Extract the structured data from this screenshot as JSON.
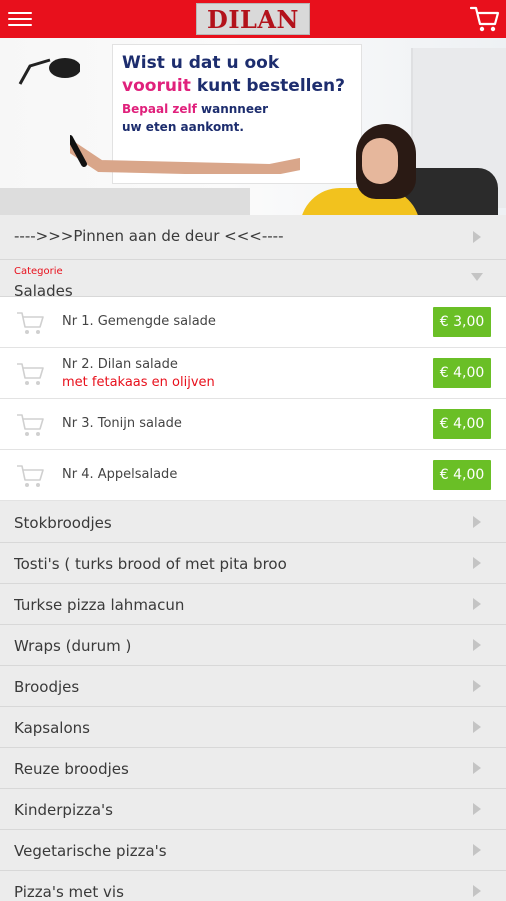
{
  "header": {
    "brand": "DILAN",
    "menu_icon": "hamburger-menu-icon",
    "cart_icon": "shopping-cart-icon",
    "bar_color": "#e8101c"
  },
  "banner": {
    "line1": "Wist u dat u ook",
    "line2_a": "vooruit",
    "line2_b": "kunt bestellen?",
    "line3_a": "Bepaal zelf",
    "line3_b": "wannneer",
    "line4": "uw eten aankomt."
  },
  "notice": {
    "label": "---->>>Pinnen aan de deur <<<----"
  },
  "category": {
    "caption": "Categorie",
    "selected": "Salades"
  },
  "items": [
    {
      "name": "Nr 1. Gemengde salade",
      "desc": "",
      "price": "€ 3,00"
    },
    {
      "name": "Nr 2. Dilan salade",
      "desc": "met fetakaas en olijven",
      "price": "€ 4,00"
    },
    {
      "name": "Nr 3. Tonijn salade",
      "desc": "",
      "price": "€ 4,00"
    },
    {
      "name": "Nr 4. Appelsalade",
      "desc": "",
      "price": "€ 4,00"
    }
  ],
  "categories": [
    {
      "label": "Stokbroodjes"
    },
    {
      "label": "Tosti's ( turks brood of met pita broo"
    },
    {
      "label": "Turkse pizza lahmacun"
    },
    {
      "label": "Wraps (durum )"
    },
    {
      "label": "Broodjes"
    },
    {
      "label": "Kapsalons"
    },
    {
      "label": "Reuze broodjes"
    },
    {
      "label": "Kinderpizza's"
    },
    {
      "label": "Vegetarische pizza's"
    },
    {
      "label": "Pizza's met vis"
    }
  ],
  "colors": {
    "accent": "#e8101c",
    "price": "#6abf26"
  }
}
